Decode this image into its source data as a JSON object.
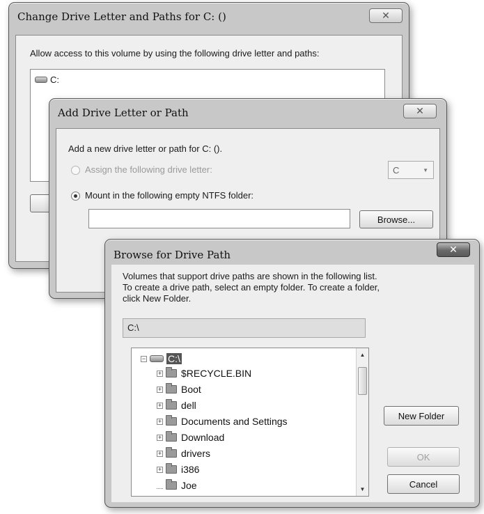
{
  "change_dialog": {
    "title": "Change Drive Letter and Paths for C: ()",
    "close_glyph": "✕",
    "description": "Allow access to this volume by using the following drive letter and paths:",
    "entries": [
      {
        "label": "C:",
        "icon": "drive-icon"
      }
    ]
  },
  "add_dialog": {
    "title": "Add Drive Letter or Path",
    "close_glyph": "✕",
    "description": "Add a new drive letter or path for C: ().",
    "assign_option_label": "Assign the following drive letter:",
    "assign_option_selected": false,
    "drive_letter_value": "C",
    "mount_option_label": "Mount in the following empty NTFS folder:",
    "mount_option_selected": true,
    "folder_path_value": "",
    "browse_button": "Browse..."
  },
  "browse_dialog": {
    "title": "Browse for Drive Path",
    "close_glyph": "✕",
    "instructions": [
      "Volumes that support drive paths are shown in the following list.",
      "To create a drive path, select an empty folder. To create a folder,",
      "click New Folder."
    ],
    "current_path": "C:\\",
    "tree": {
      "root": {
        "label": "C:\\",
        "expander": "−",
        "icon": "drive-icon",
        "selected": true
      },
      "items": [
        {
          "label": "$RECYCLE.BIN",
          "expander": "+",
          "icon": "folder-icon"
        },
        {
          "label": "Boot",
          "expander": "+",
          "icon": "folder-icon"
        },
        {
          "label": "dell",
          "expander": "+",
          "icon": "folder-icon"
        },
        {
          "label": "Documents and Settings",
          "expander": "+",
          "icon": "folder-icon"
        },
        {
          "label": "Download",
          "expander": "+",
          "icon": "folder-icon"
        },
        {
          "label": "drivers",
          "expander": "+",
          "icon": "folder-icon"
        },
        {
          "label": "i386",
          "expander": "+",
          "icon": "folder-icon"
        },
        {
          "label": "Joe",
          "expander": "",
          "icon": "folder-icon"
        }
      ]
    },
    "new_folder_button": "New Folder",
    "ok_button": "OK",
    "ok_enabled": false,
    "cancel_button": "Cancel"
  },
  "colors": {
    "window_frame": "#c8c8c8",
    "dialog_body": "#efefef",
    "selection": "#555555"
  }
}
